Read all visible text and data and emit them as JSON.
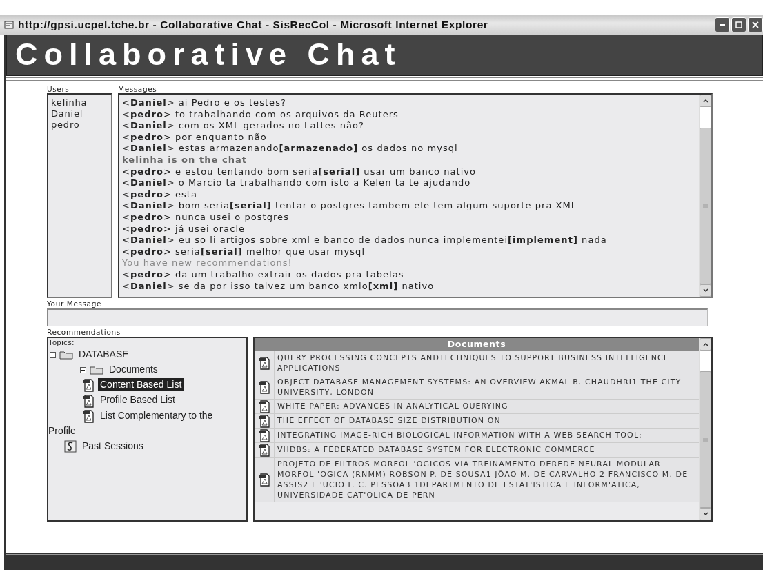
{
  "window": {
    "title": "http://gpsi.ucpel.tche.br - Collaborative Chat - SisRecCol - Microsoft Internet Explorer"
  },
  "header": {
    "title": "Collaborative Chat"
  },
  "users": {
    "label": "Users",
    "items": [
      "kelinha",
      "Daniel",
      "pedro"
    ]
  },
  "messages": {
    "label": "Messages",
    "items": [
      {
        "kind": "chat",
        "user": "<**Daniel**>",
        "text": "ai Pedro e os testes?"
      },
      {
        "kind": "chat",
        "user": "<**pedro**>",
        "text": "to trabalhando com os arquivos da Reuters"
      },
      {
        "kind": "chat",
        "user": "<**Daniel**>",
        "text": "com os XML gerados no Lattes não?"
      },
      {
        "kind": "chat",
        "user": "<**pedro**>",
        "text": "por enquanto não"
      },
      {
        "kind": "chat",
        "user": "<**Daniel**>",
        "text": "estas armazenando**[armazenado]** os dados no mysql"
      },
      {
        "kind": "system",
        "text": "**kelinha is on the chat**"
      },
      {
        "kind": "chat",
        "user": "<**pedro**>",
        "text": "e estou tentando bom seria**[serial]** usar um banco nativo"
      },
      {
        "kind": "chat",
        "user": "<**Daniel**>",
        "text": "o Marcio ta trabalhando com isto a Kelen ta te ajudando"
      },
      {
        "kind": "chat",
        "user": "<**pedro**>",
        "text": "esta"
      },
      {
        "kind": "chat",
        "user": "<**Daniel**>",
        "text": "bom seria**[serial]** tentar o postgres tambem ele tem algum suporte pra XML"
      },
      {
        "kind": "chat",
        "user": "<**pedro**>",
        "text": "nunca usei o postgres"
      },
      {
        "kind": "chat",
        "user": "<**pedro**>",
        "text": "já usei oracle"
      },
      {
        "kind": "chat",
        "user": "<**Daniel**>",
        "text": "eu so li artigos sobre xml e banco de dados nunca implementei**[implement]** nada"
      },
      {
        "kind": "chat",
        "user": "<**pedro**>",
        "text": "seria**[serial]** melhor que usar mysql"
      },
      {
        "kind": "notice",
        "text": "You have new recommendations!"
      },
      {
        "kind": "chat",
        "user": "<**pedro**>",
        "text": "da um trabalho extrair os dados pra tabelas"
      },
      {
        "kind": "chat",
        "user": "<**Daniel**>",
        "text": "se da por isso talvez um banco xmlo**[xml]** nativo"
      }
    ]
  },
  "your_message": {
    "label": "Your Message"
  },
  "recommendations": {
    "label": "Recommendations",
    "topics": {
      "label": "Topics:",
      "tree": [
        {
          "kind": "folder",
          "label": "DATABASE",
          "expanded": true,
          "selected": false,
          "children": [
            {
              "kind": "folder",
              "label": "Documents",
              "expanded": true,
              "selected": false,
              "children": [
                {
                  "kind": "document",
                  "label": "Content Based List",
                  "selected": true
                },
                {
                  "kind": "document",
                  "label": "Profile Based List",
                  "selected": false
                },
                {
                  "kind": "document",
                  "label": "List Complementary to the Profile",
                  "selected": false
                }
              ]
            },
            {
              "kind": "session",
              "label": "Past Sessions",
              "selected": false
            }
          ]
        }
      ]
    },
    "documents": {
      "heading": "Documents",
      "items": [
        "QUERY PROCESSING CONCEPTS ANDTECHNIQUES TO SUPPORT BUSINESS INTELLIGENCE APPLICATIONS",
        "OBJECT DATABASE MANAGEMENT SYSTEMS: AN OVERVIEW AKMAL B. CHAUDHRI1 THE CITY UNIVERSITY, LONDON",
        "WHITE PAPER: ADVANCES IN ANALYTICAL QUERYING",
        "THE EFFECT OF DATABASE SIZE DISTRIBUTION ON",
        "INTEGRATING IMAGE-RICH BIOLOGICAL INFORMATION WITH A WEB SEARCH TOOL:",
        "VHDBS: A FEDERATED DATABASE SYSTEM FOR ELECTRONIC COMMERCE",
        "PROJETO DE FILTROS MORFOL 'OGICOS VIA TREINAMENTO DEREDE NEURAL MODULAR MORFOL 'OGICA (RNMM) ROBSON P. DE SOUSA1 JÕAO M. DE CARVALHO 2 FRANCISCO M. DE ASSIS2 L 'UCIO F. C. PESSOA3 1DEPARTMENTO DE ESTAT'ISTICA E INFORM'ATICA, UNIVERSIDADE CAT'OLICA DE PERN"
      ]
    }
  }
}
